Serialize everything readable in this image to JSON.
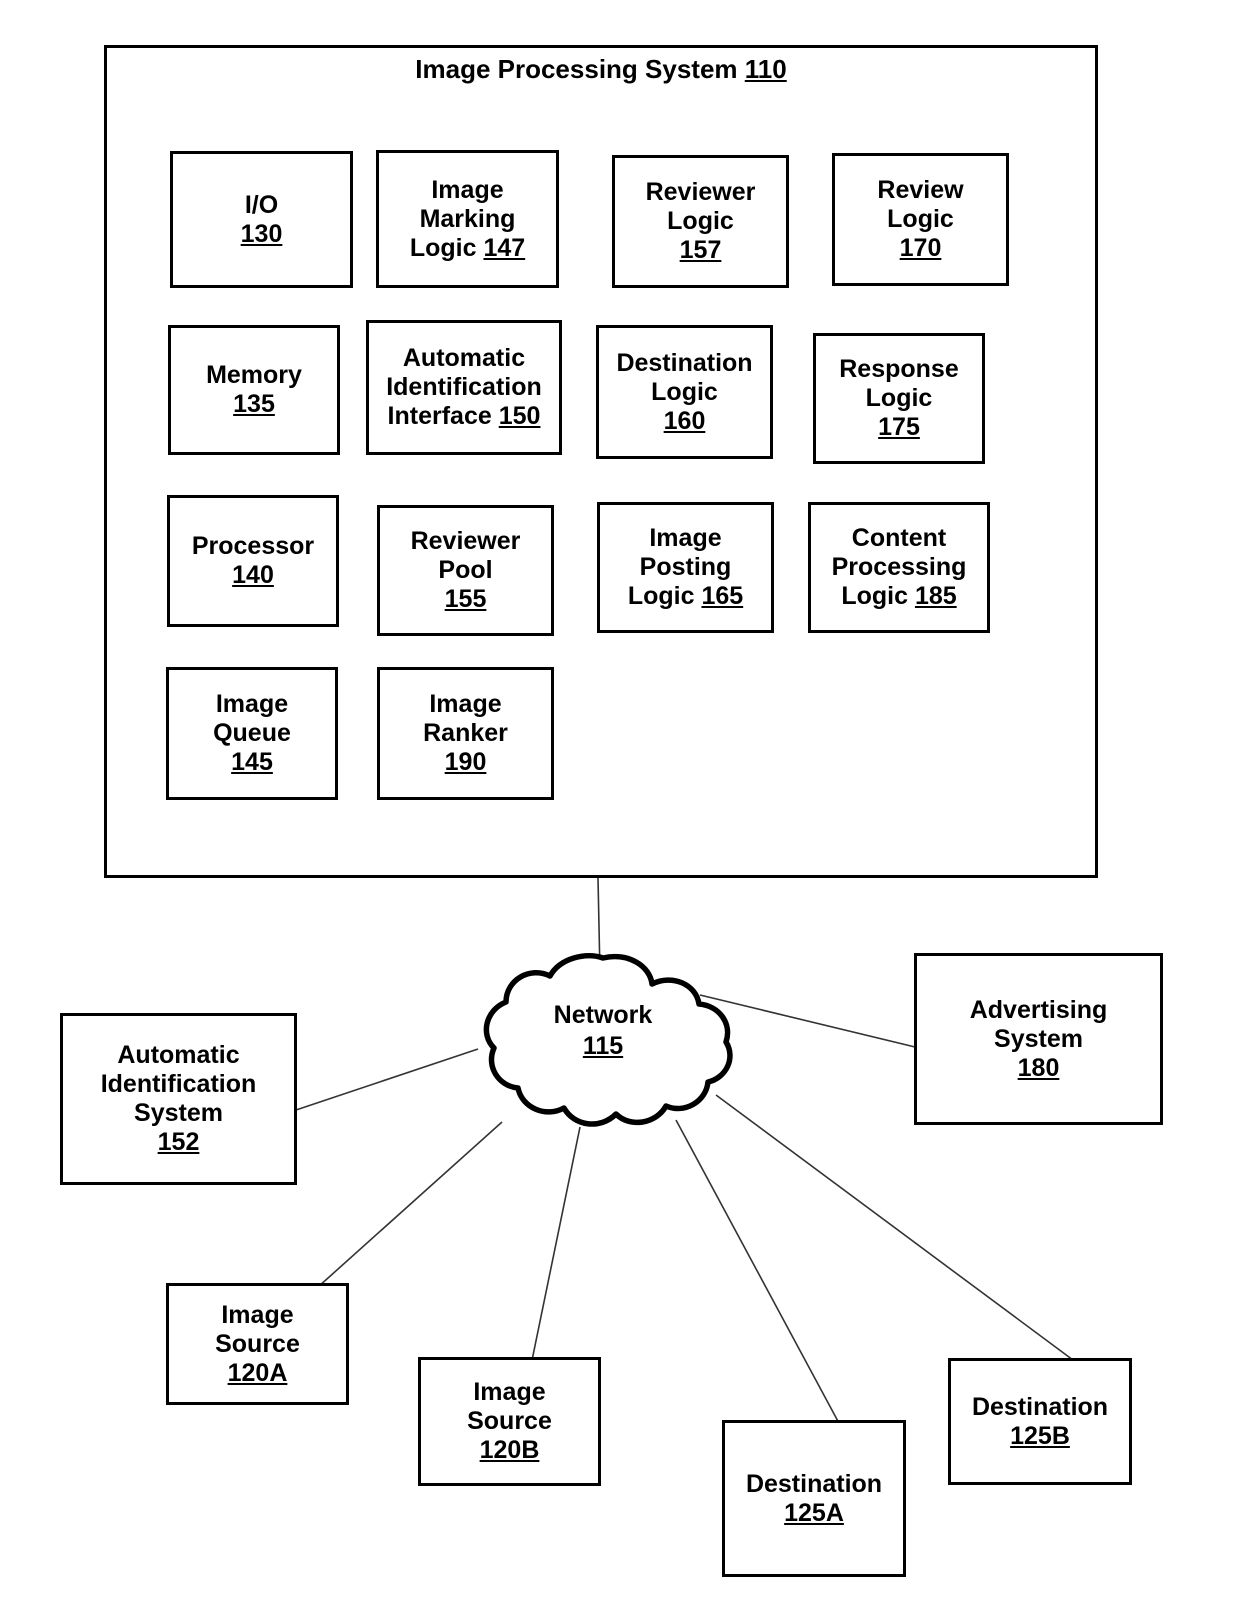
{
  "figure": {
    "title": "Image Processing System Diagram",
    "system": {
      "label": "Image Processing System",
      "ref": "110",
      "title_full": "Image Processing System 110"
    },
    "components": [
      {
        "name": "io",
        "lines": [
          "I/O"
        ],
        "ref": "130",
        "ref_inline": false
      },
      {
        "name": "image-marking-logic",
        "lines": [
          "Image",
          "Marking"
        ],
        "ref": "147",
        "ref_inline": true,
        "inline_prefix": "Logic"
      },
      {
        "name": "reviewer-logic",
        "lines": [
          "Reviewer",
          "Logic"
        ],
        "ref": "157",
        "ref_inline": false
      },
      {
        "name": "review-logic",
        "lines": [
          "Review",
          "Logic"
        ],
        "ref": "170",
        "ref_inline": false
      },
      {
        "name": "memory",
        "lines": [
          "Memory"
        ],
        "ref": "135",
        "ref_inline": false
      },
      {
        "name": "automatic-identification-interface",
        "lines": [
          "Automatic",
          "Identification"
        ],
        "ref": "150",
        "ref_inline": true,
        "inline_prefix": "Interface"
      },
      {
        "name": "destination-logic",
        "lines": [
          "Destination",
          "Logic"
        ],
        "ref": "160",
        "ref_inline": false
      },
      {
        "name": "response-logic",
        "lines": [
          "Response",
          "Logic"
        ],
        "ref": "175",
        "ref_inline": false
      },
      {
        "name": "processor",
        "lines": [
          "Processor"
        ],
        "ref": "140",
        "ref_inline": false
      },
      {
        "name": "reviewer-pool",
        "lines": [
          "Reviewer",
          "Pool"
        ],
        "ref": "155",
        "ref_inline": false
      },
      {
        "name": "image-posting-logic",
        "lines": [
          "Image",
          "Posting"
        ],
        "ref": "165",
        "ref_inline": true,
        "inline_prefix": "Logic"
      },
      {
        "name": "content-processing-logic",
        "lines": [
          "Content",
          "Processing"
        ],
        "ref": "185",
        "ref_inline": true,
        "inline_prefix": "Logic"
      },
      {
        "name": "image-queue",
        "lines": [
          "Image",
          "Queue"
        ],
        "ref": "145",
        "ref_inline": false
      },
      {
        "name": "image-ranker",
        "lines": [
          "Image",
          "Ranker"
        ],
        "ref": "190",
        "ref_inline": false
      }
    ],
    "network": {
      "label": "Network",
      "ref": "115"
    },
    "external_nodes": [
      {
        "name": "automatic-identification-system",
        "lines": [
          "Automatic",
          "Identification",
          "System"
        ],
        "ref": "152"
      },
      {
        "name": "advertising-system",
        "lines": [
          "Advertising",
          "System"
        ],
        "ref": "180"
      },
      {
        "name": "image-source-a",
        "lines": [
          "Image",
          "Source"
        ],
        "ref": "120A"
      },
      {
        "name": "image-source-b",
        "lines": [
          "Image",
          "Source"
        ],
        "ref": "120B"
      },
      {
        "name": "destination-a",
        "lines": [
          "Destination"
        ],
        "ref": "125A"
      },
      {
        "name": "destination-b",
        "lines": [
          "Destination"
        ],
        "ref": "125B"
      }
    ],
    "connections": [
      {
        "from": "image-processing-system",
        "to": "network"
      },
      {
        "from": "automatic-identification-system",
        "to": "network"
      },
      {
        "from": "advertising-system",
        "to": "network"
      },
      {
        "from": "image-source-a",
        "to": "network"
      },
      {
        "from": "image-source-b",
        "to": "network"
      },
      {
        "from": "destination-a",
        "to": "network"
      },
      {
        "from": "destination-b",
        "to": "network"
      }
    ],
    "colors": {
      "background": "#ffffff",
      "stroke": "#000000",
      "connector": "#333333"
    }
  }
}
